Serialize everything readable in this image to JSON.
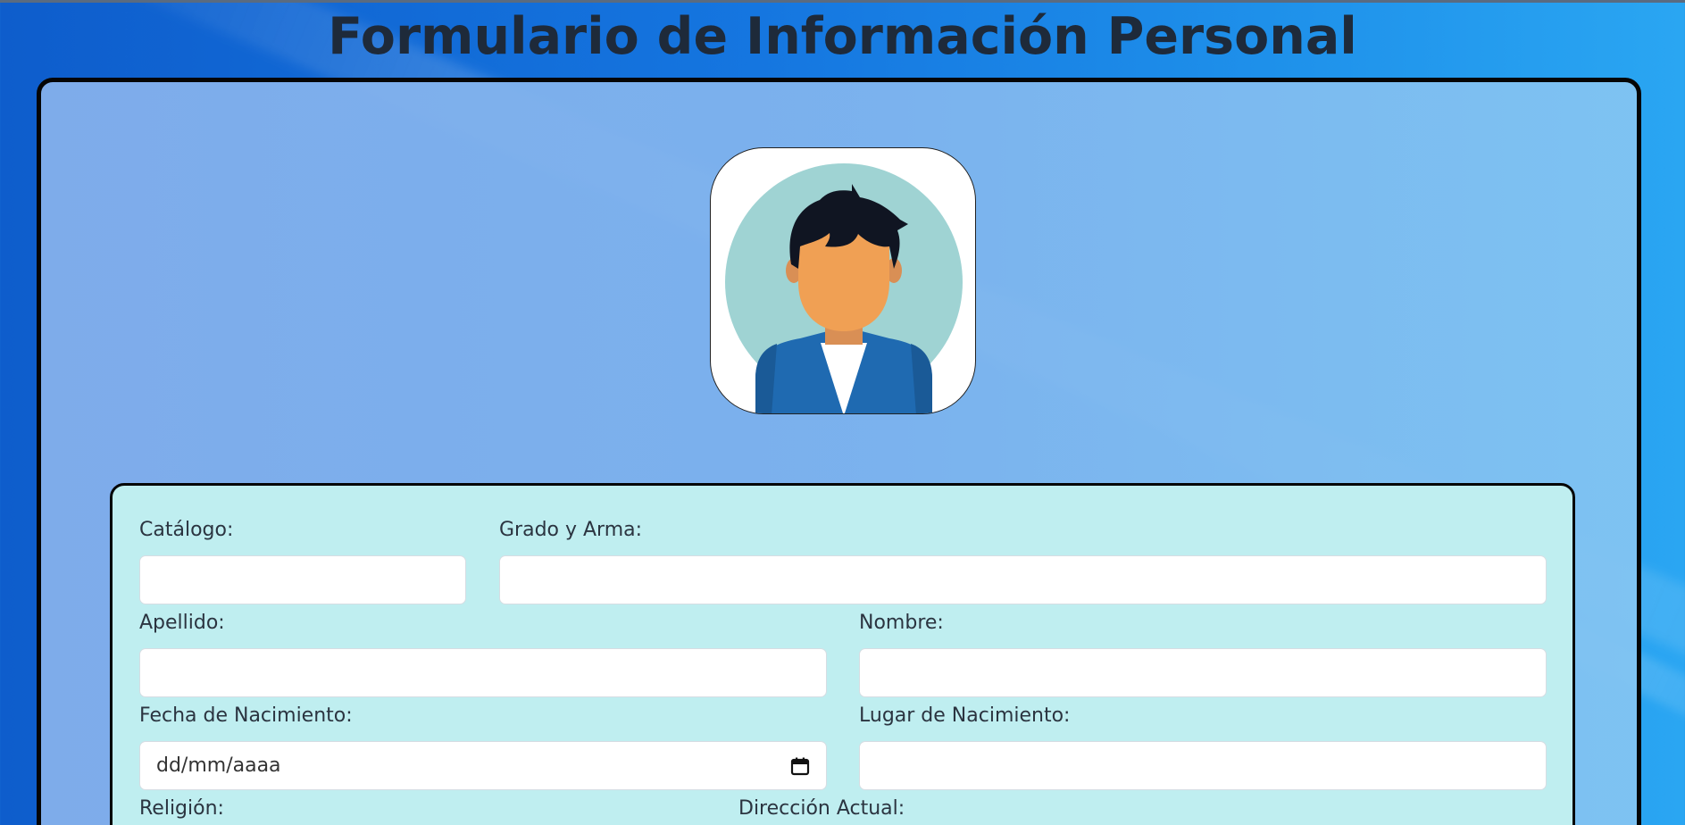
{
  "page": {
    "title": "Formulario de Información Personal"
  },
  "avatar": {
    "icon": "person-avatar-icon"
  },
  "form": {
    "catalogo": {
      "label": "Catálogo:",
      "value": ""
    },
    "grado_arma": {
      "label": "Grado y Arma:",
      "value": ""
    },
    "apellido": {
      "label": "Apellido:",
      "value": ""
    },
    "nombre": {
      "label": "Nombre:",
      "value": ""
    },
    "fecha_nacimiento": {
      "label": "Fecha de Nacimiento:",
      "placeholder": "dd/mm/aaaa",
      "icon": "calendar-icon"
    },
    "lugar_nacimiento": {
      "label": "Lugar de Nacimiento:",
      "value": ""
    },
    "religion": {
      "label": "Religión:"
    },
    "direccion_actual": {
      "label": "Dirección Actual:"
    }
  },
  "colors": {
    "background_start": "#0e5dcc",
    "background_end": "#2aa6f2",
    "card_fill": "#84b0ec",
    "form_panel_fill": "#bfeef0",
    "title_text": "#1e2a3a",
    "border": "#050505"
  }
}
